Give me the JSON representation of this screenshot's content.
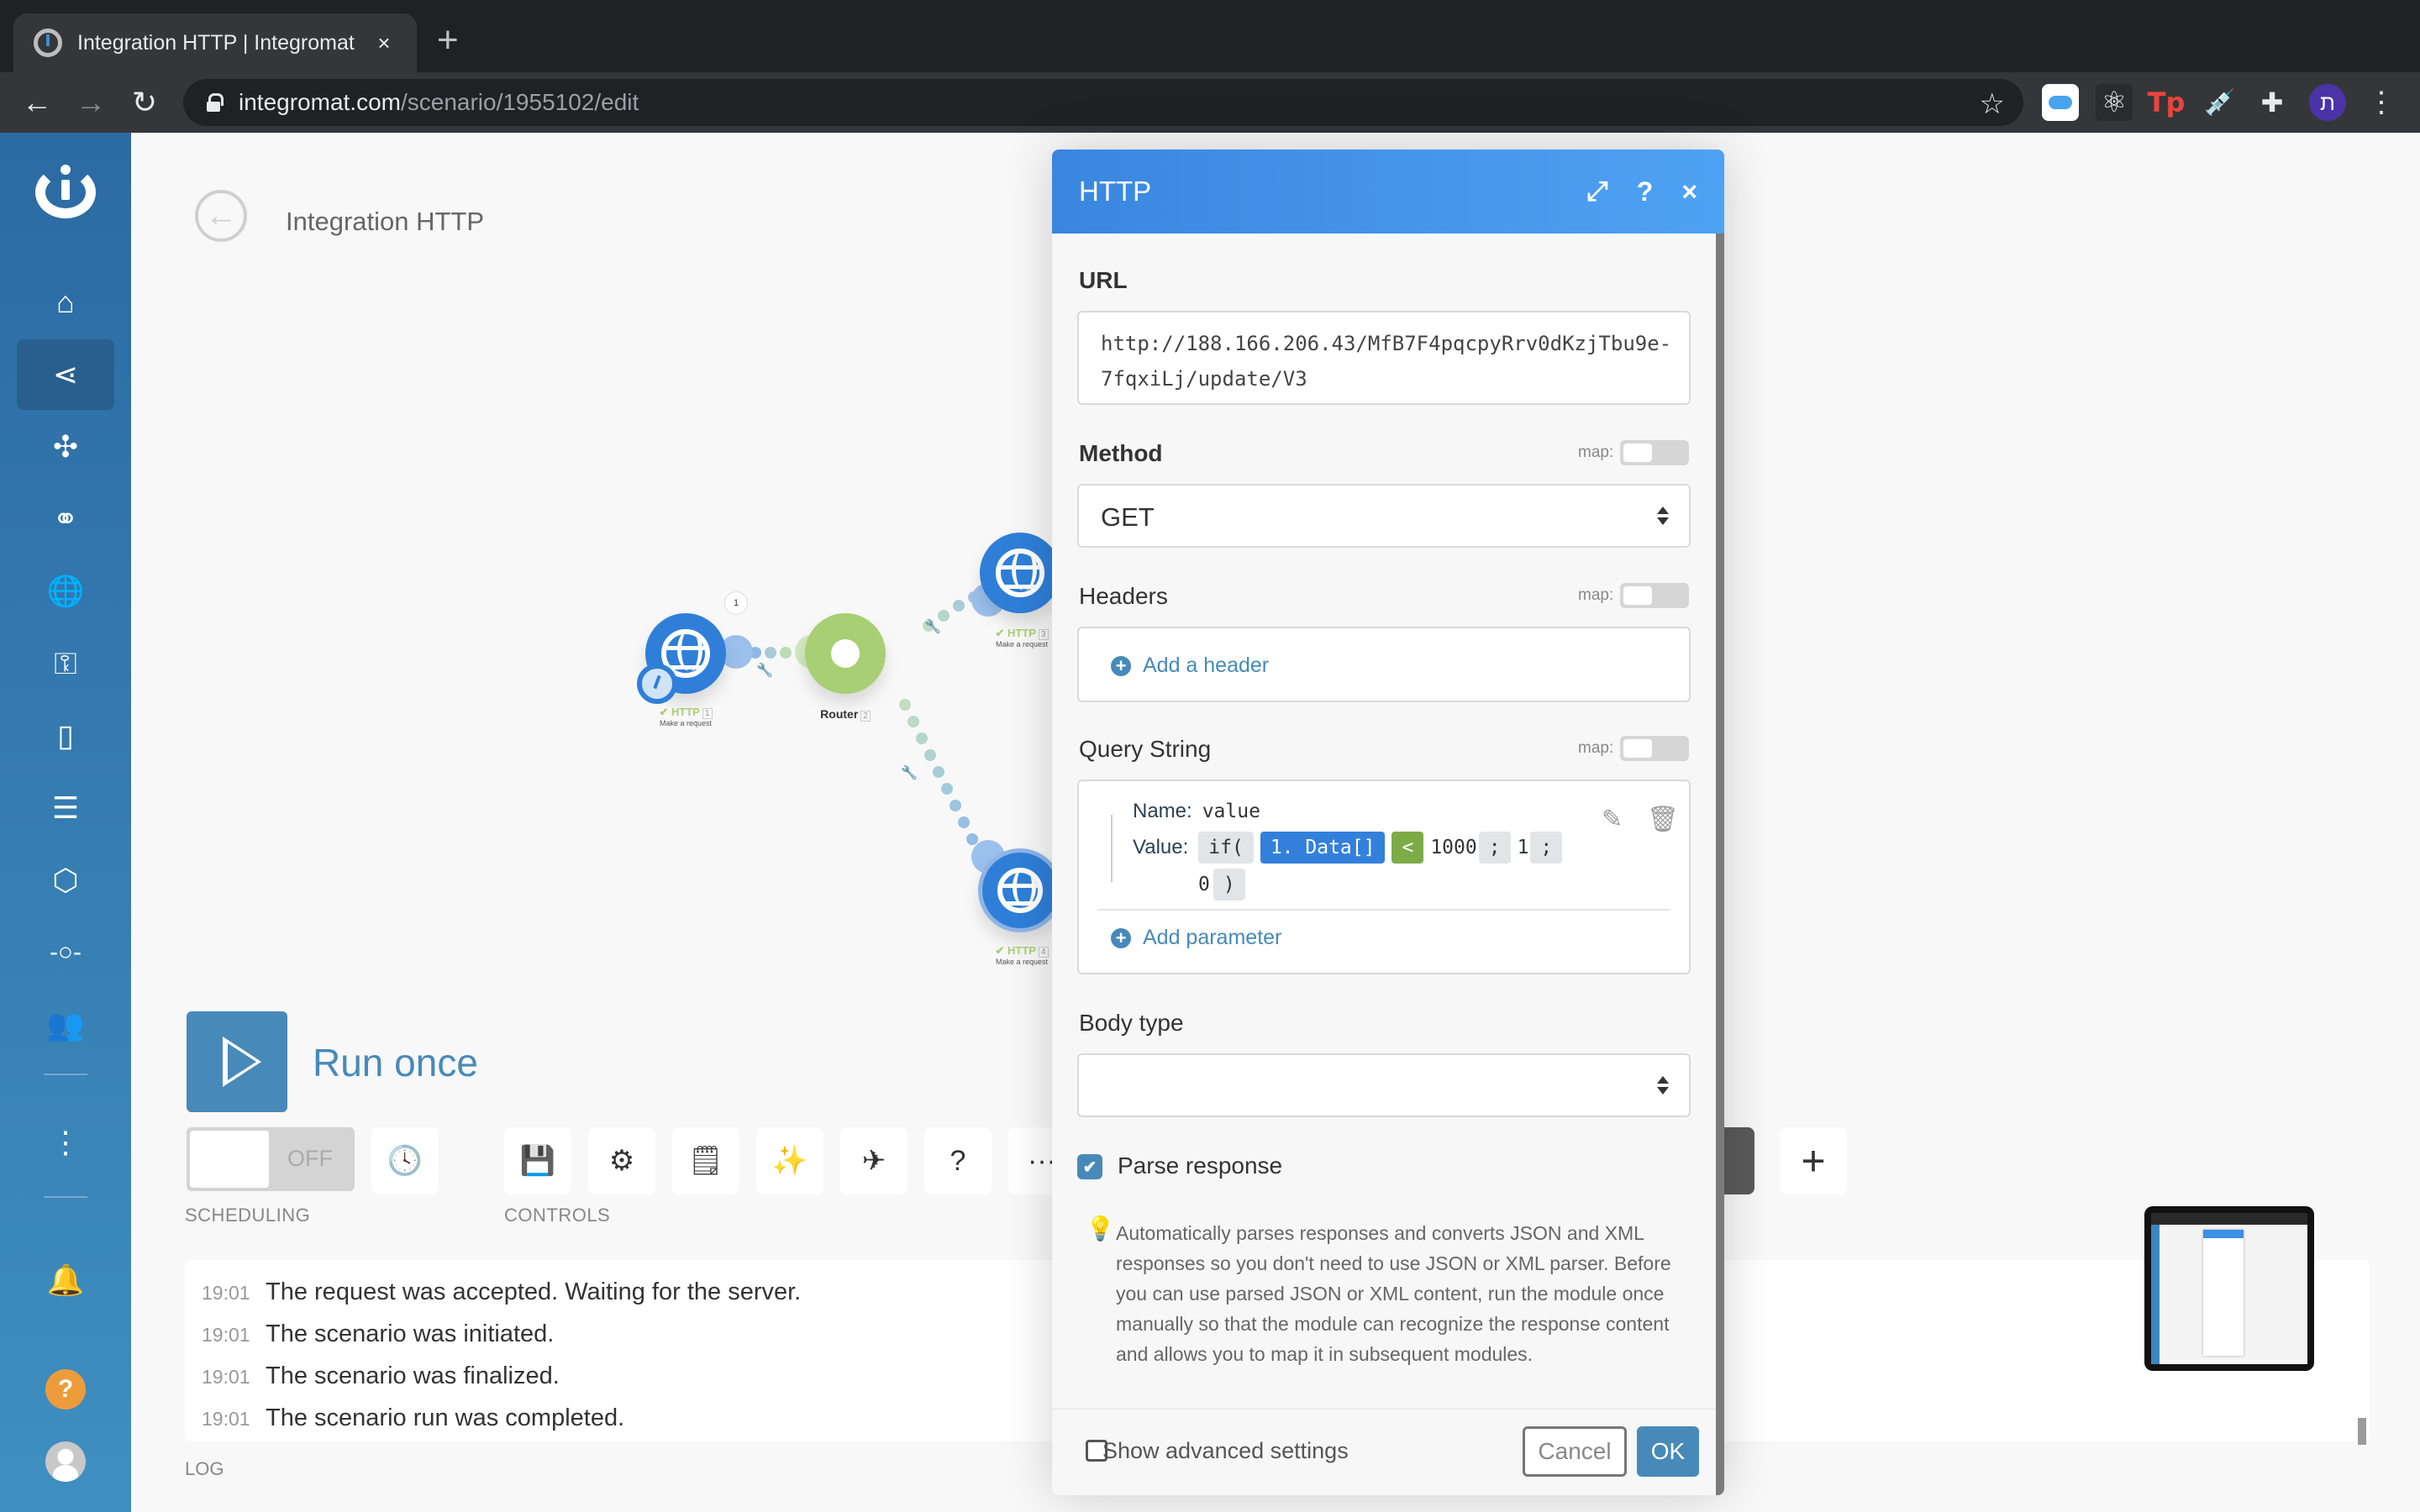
{
  "browser": {
    "tab_title": "Integration HTTP | Integromat",
    "tab_close": "×",
    "new_tab": "+",
    "url_host": "integromat.com",
    "url_path": "/scenario/1955102/edit",
    "profile_initial": "ת",
    "extensions": [
      "icloud-icon",
      "react-devtools-icon",
      "tp-icon",
      "syringe-icon",
      "extensions-puzzle-icon"
    ]
  },
  "sidebar": {
    "items": [
      {
        "name": "home",
        "glyph": "⌂"
      },
      {
        "name": "scenarios",
        "glyph": "⋖",
        "active": true
      },
      {
        "name": "templates",
        "glyph": "✣"
      },
      {
        "name": "connections",
        "glyph": "⚭"
      },
      {
        "name": "webhooks",
        "glyph": "🌐"
      },
      {
        "name": "keys",
        "glyph": "⚿"
      },
      {
        "name": "devices",
        "glyph": "▯"
      },
      {
        "name": "data-stores",
        "glyph": "☰"
      },
      {
        "name": "data-structures",
        "glyph": "⬡"
      },
      {
        "name": "flow",
        "glyph": "-○-"
      },
      {
        "name": "team",
        "glyph": "👥"
      },
      {
        "name": "more",
        "glyph": "⋮"
      },
      {
        "name": "notifications",
        "glyph": "🔔"
      }
    ],
    "help_glyph": "?"
  },
  "scenario": {
    "title": "Integration HTTP",
    "back_glyph": "←",
    "nodes": [
      {
        "id": 1,
        "title": "HTTP",
        "subtitle": "Make a request",
        "type": "http",
        "status": "ok",
        "bubble": "1"
      },
      {
        "id": 2,
        "title": "Router",
        "subtitle": "",
        "type": "router"
      },
      {
        "id": 3,
        "title": "HTTP",
        "subtitle": "Make a request",
        "type": "http",
        "status": "ok"
      },
      {
        "id": 4,
        "title": "HTTP",
        "subtitle": "Make a request",
        "type": "http",
        "status": "ok"
      }
    ]
  },
  "controls": {
    "run_once": "Run once",
    "scheduling_state": "OFF",
    "scheduling_caption": "SCHEDULING",
    "controls_caption": "CONTROLS",
    "more": "···",
    "plus": "+"
  },
  "log": {
    "caption": "LOG",
    "entries": [
      {
        "time": "19:01",
        "message": "The request was accepted. Waiting for the server."
      },
      {
        "time": "19:01",
        "message": "The scenario was initiated."
      },
      {
        "time": "19:01",
        "message": "The scenario was finalized."
      },
      {
        "time": "19:01",
        "message": "The scenario run was completed."
      }
    ]
  },
  "modal": {
    "title": "HTTP",
    "url_label": "URL",
    "url_value": "http://188.166.206.43/MfB7F4pqcpyRrv0dKzjTbu9e-7fqxiLj/update/V3",
    "method_label": "Method",
    "method_value": "GET",
    "map_label": "map:",
    "headers_label": "Headers",
    "add_header": "Add a header",
    "query_label": "Query String",
    "query_params": [
      {
        "name_key": "Name:",
        "name": "value",
        "value_key": "Value:",
        "value_tokens": [
          "if(",
          "1. Data[]",
          "<",
          "1000",
          ";",
          "1",
          ";",
          "0",
          ")"
        ]
      }
    ],
    "add_parameter": "Add parameter",
    "body_type_label": "Body type",
    "body_type_value": "",
    "parse_response_label": "Parse response",
    "parse_response_checked": true,
    "parse_help": "Automatically parses responses and converts JSON and XML responses so you don't need to use JSON or XML parser. Before you can use parsed JSON or XML content, run the module once manually so that the module can recognize the response content and allows you to map it in subsequent modules.",
    "show_advanced": "Show advanced settings",
    "show_advanced_checked": false,
    "cancel": "Cancel",
    "ok": "OK"
  },
  "colors": {
    "brand_blue": "#478ab9",
    "http_node": "#2f7fd9",
    "router_node": "#a8cf74",
    "modal_header": "#3a86df",
    "help_orange": "#ed9c3b"
  }
}
